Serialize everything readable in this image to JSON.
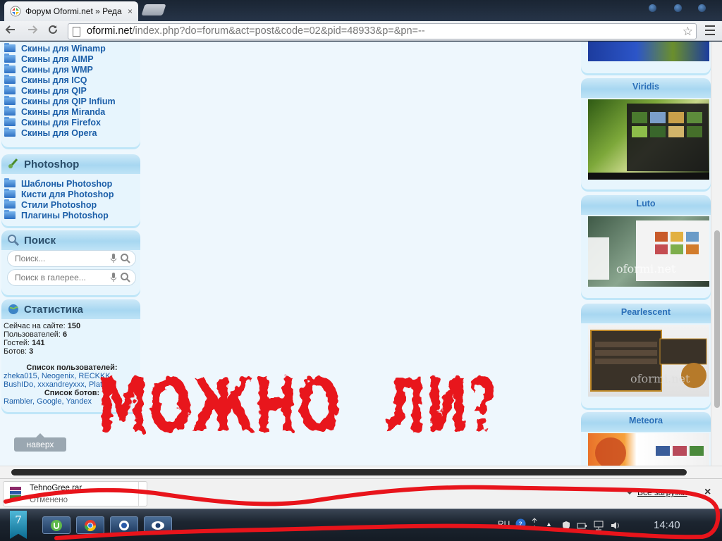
{
  "browser": {
    "tab_title": "Форум Oformi.net » Реда",
    "tab_close": "×",
    "url_host": "oformi.net",
    "url_path": "/index.php?do=forum&act=post&code=02&pid=48933&p=&pn=--",
    "back_icon": "arrow-left-icon",
    "forward_icon": "arrow-right-icon",
    "reload_icon": "reload-icon",
    "star_icon": "bookmark-star-icon"
  },
  "sidebar": {
    "skins": [
      {
        "label": "Скины для Winamp"
      },
      {
        "label": "Скины для AIMP"
      },
      {
        "label": "Скины для WMP"
      },
      {
        "label": "Скины для ICQ"
      },
      {
        "label": "Скины для QIP"
      },
      {
        "label": "Скины для QIP Infium"
      },
      {
        "label": "Скины для Miranda"
      },
      {
        "label": "Скины для Firefox"
      },
      {
        "label": "Скины для Opera"
      }
    ],
    "photoshop": {
      "title": "Photoshop",
      "items": [
        {
          "label": "Шаблоны Photoshop"
        },
        {
          "label": "Кисти для Photoshop"
        },
        {
          "label": "Стили Photoshop"
        },
        {
          "label": "Плагины Photoshop"
        }
      ]
    },
    "search": {
      "title": "Поиск",
      "site_placeholder": "Поиск...",
      "gallery_placeholder": "Поиск в галерее..."
    },
    "stats": {
      "title": "Статистика",
      "online_label": "Сейчас на сайте:",
      "online_value": "150",
      "users_label": "Пользователей:",
      "users_value": "6",
      "guests_label": "Гостей:",
      "guests_value": "141",
      "bots_label": "Ботов:",
      "bots_value": "3",
      "user_list_title": "Список пользователей:",
      "user_list_line1": "zheka015, Neogenix, RECKKK,",
      "user_list_line2": "BushIDo, xxxandreyxxx, Plat",
      "bot_list_title": "Список ботов:",
      "bot_list": "Rambler, Google, Yandex"
    },
    "up_button": "наверх"
  },
  "right_sidebar": {
    "themes": [
      {
        "title": "Viridis"
      },
      {
        "title": "Luto"
      },
      {
        "title": "Pearlescent"
      },
      {
        "title": "Meteora"
      }
    ],
    "watermark": "oformi.net"
  },
  "overlay_text": {
    "word1": "МОЖНО",
    "word2": "ЛИ?",
    "color": "#e8141b"
  },
  "download_shelf": {
    "file_name": "TehnoGree.rar",
    "status": "Отменено",
    "all_downloads": "Все загрузки",
    "close": "×"
  },
  "taskbar": {
    "start_label": "7",
    "lang": "RU",
    "clock": "14:40",
    "apps": [
      "utorrent-icon",
      "chrome-icon",
      "app-icon",
      "eye-icon"
    ]
  }
}
